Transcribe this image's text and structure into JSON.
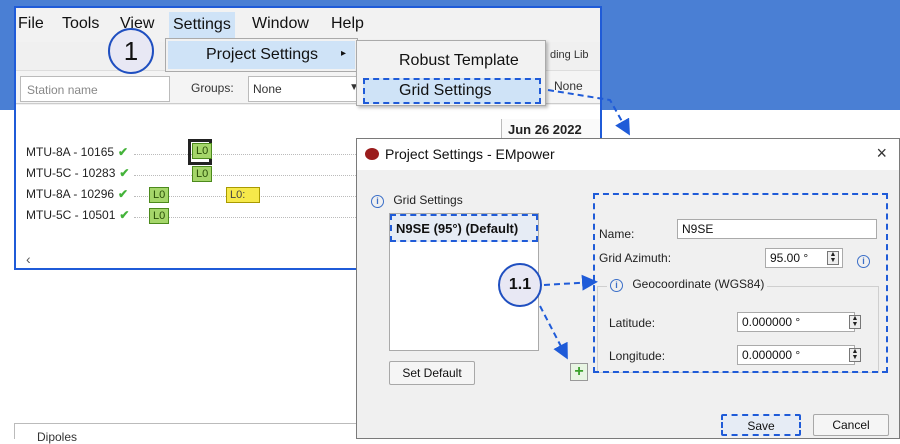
{
  "colors": {
    "banner": "#4a7fd4",
    "accent_dash": "#1f5bd8",
    "tag_green": "#a5d66a",
    "tag_yellow": "#f6e94a"
  },
  "menubar": {
    "file": "File",
    "tools": "Tools",
    "view": "View",
    "settings": "Settings",
    "window": "Window",
    "help": "Help"
  },
  "settings_menu": {
    "project_settings": "Project Settings",
    "arrow": "▸"
  },
  "project_settings_submenu": {
    "robust_template": "Robust Template",
    "grid_settings": "Grid Settings"
  },
  "toolbar": {
    "station_placeholder": "Station name",
    "groups_label": "Groups:",
    "groups_value": "None",
    "right_value": "None",
    "library_label": "ding Lib"
  },
  "timeline": {
    "date": "Jun 26 2022",
    "stations": [
      {
        "name": "MTU-8A - 10165",
        "tags": [
          {
            "text": "L0",
            "color": "green",
            "selected": true
          }
        ]
      },
      {
        "name": "MTU-5C - 10283",
        "tags": [
          {
            "text": "L0",
            "color": "green"
          }
        ]
      },
      {
        "name": "MTU-8A - 10296",
        "tags": [
          {
            "text": "L0",
            "color": "green"
          },
          {
            "text": "L0:",
            "color": "yellow"
          }
        ]
      },
      {
        "name": "MTU-5C - 10501",
        "tags": [
          {
            "text": "L0",
            "color": "green"
          }
        ]
      }
    ],
    "scroll_left": "‹"
  },
  "callouts": {
    "step1": "1",
    "step1_1": "1.1"
  },
  "dialog": {
    "title": "Project Settings - EMpower",
    "close": "×",
    "grid_settings_label": "Grid Settings",
    "grid_list": [
      "N9SE (95°) (Default)"
    ],
    "set_default": "Set Default",
    "add": "+",
    "name_label": "Name:",
    "name_value": "N9SE",
    "azimuth_label": "Grid Azimuth:",
    "azimuth_value": "95.00 °",
    "geocoord_label": "Geocoordinate (WGS84)",
    "latitude_label": "Latitude:",
    "latitude_value": "0.000000 °",
    "longitude_label": "Longitude:",
    "longitude_value": "0.000000 °",
    "save": "Save",
    "cancel": "Cancel",
    "info_icon": "i"
  },
  "dipoles_label": "Dipoles"
}
